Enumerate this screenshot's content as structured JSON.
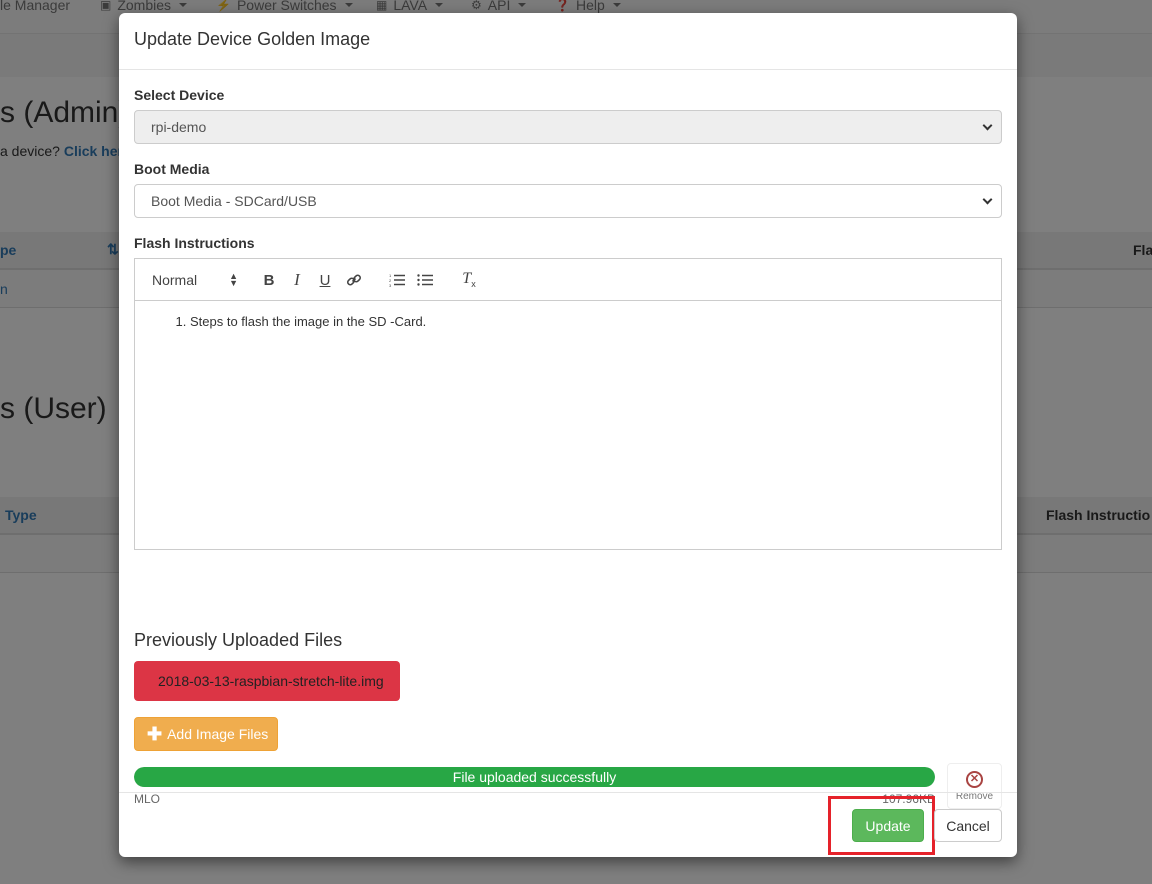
{
  "navbar": {
    "items": [
      {
        "label": "le Manager",
        "icon": ""
      },
      {
        "label": "Zombies",
        "icon": "zombie-icon"
      },
      {
        "label": "Power Switches",
        "icon": "bolt-icon"
      },
      {
        "label": "LAVA",
        "icon": "table-icon"
      },
      {
        "label": "API",
        "icon": "gear-icon"
      },
      {
        "label": "Help",
        "icon": "question-icon"
      }
    ]
  },
  "background": {
    "admin_heading": "s (Admin)",
    "admin_subtext": "a device?",
    "admin_link": "Click her",
    "admin_col1": "pe",
    "admin_col_flash": "Fla",
    "admin_row_text": "n",
    "user_heading": "s (User)",
    "user_col1": "Type",
    "user_col_flash": "Flash Instructio"
  },
  "modal": {
    "title": "Update Device Golden Image",
    "select_device_label": "Select Device",
    "select_device_value": "rpi-demo",
    "boot_media_label": "Boot Media",
    "boot_media_value": "Boot Media - SDCard/USB",
    "flash_label": "Flash Instructions",
    "editor": {
      "format": "Normal",
      "content_items": [
        "Steps to flash the image in the SD -Card."
      ]
    },
    "uploaded_title": "Previously Uploaded Files",
    "uploaded_file": "2018-03-13-raspbian-stretch-lite.img",
    "add_button": "Add Image Files",
    "upload": {
      "status": "File uploaded successfully",
      "progress_percent": 100,
      "file_name": "MLO",
      "file_size": "107.96KB",
      "remove_label": "Remove"
    },
    "footer": {
      "update": "Update",
      "cancel": "Cancel"
    }
  },
  "colors": {
    "danger": "#dc3545",
    "warning": "#f0ad4e",
    "success": "#5cb85c",
    "progress": "#28a745",
    "highlight": "#e5222a"
  }
}
